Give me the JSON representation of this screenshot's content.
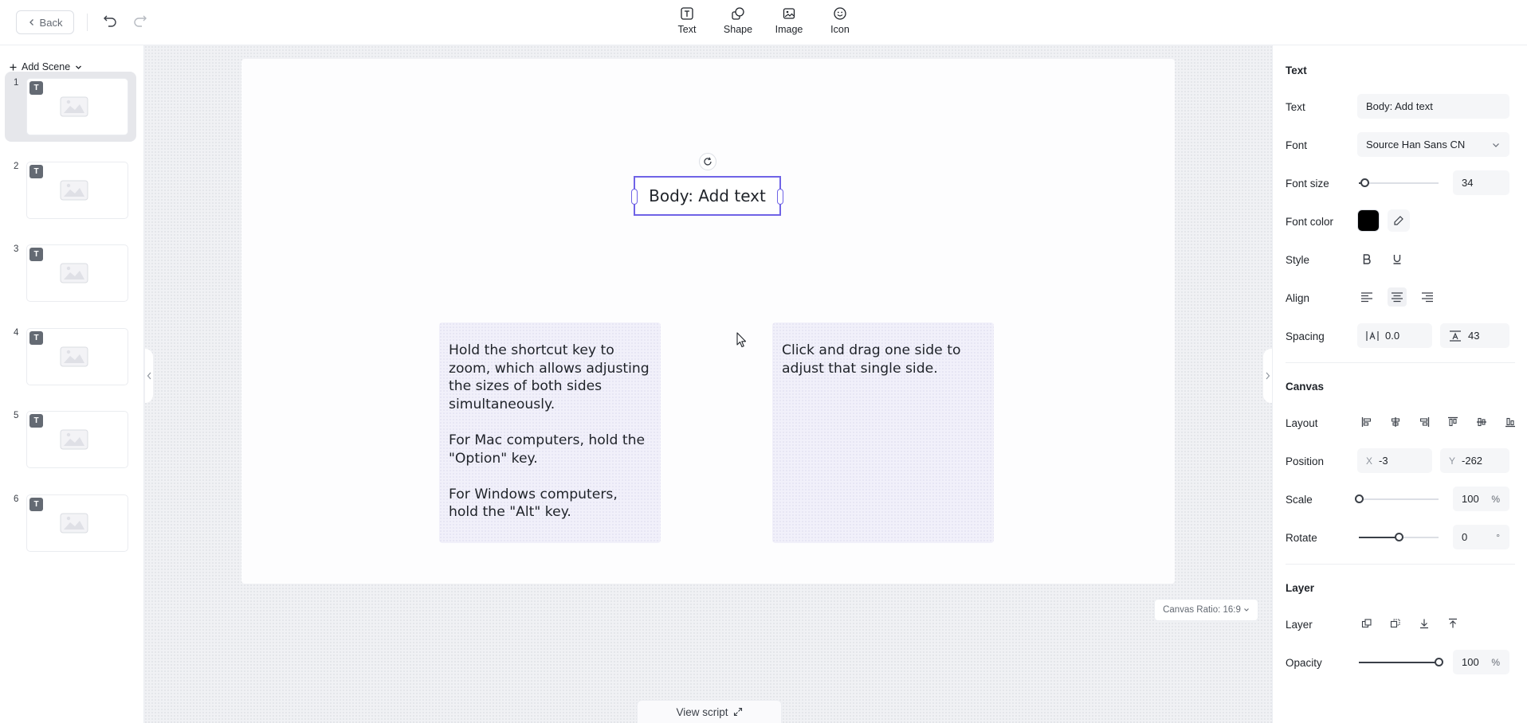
{
  "colors": {
    "accent": "#6f63e6",
    "font_color": "#000000",
    "card_bg": "#f1f0fa",
    "canvas_bg": "#f0f1f4"
  },
  "topbar": {
    "back_label": "Back",
    "tools": [
      {
        "label": "Text",
        "icon": "text-icon"
      },
      {
        "label": "Shape",
        "icon": "shape-icon"
      },
      {
        "label": "Image",
        "icon": "image-icon"
      },
      {
        "label": "Icon",
        "icon": "smiley-icon"
      }
    ]
  },
  "left_panel": {
    "add_scene_label": "Add Scene",
    "scenes": [
      {
        "number": "1",
        "badge": "T",
        "active": true
      },
      {
        "number": "2",
        "badge": "T",
        "active": false
      },
      {
        "number": "3",
        "badge": "T",
        "active": false
      },
      {
        "number": "4",
        "badge": "T",
        "active": false
      },
      {
        "number": "5",
        "badge": "T",
        "active": false
      },
      {
        "number": "6",
        "badge": "T",
        "active": false
      }
    ]
  },
  "canvas": {
    "selected_text": "Body: Add text",
    "card1": {
      "paragraphs": [
        "Hold the shortcut key to zoom, which allows adjusting the sizes of both sides simultaneously.",
        "For Mac computers, hold the \"Option\" key.",
        "For Windows computers, hold the \"Alt\" key."
      ]
    },
    "card2": {
      "paragraphs": [
        "Click and drag one side to adjust that single side."
      ]
    },
    "canvas_ratio_label": "Canvas Ratio: 16:9",
    "view_script_label": "View script"
  },
  "right_panel": {
    "text_section": {
      "title": "Text",
      "text_label": "Text",
      "text_value": "Body: Add text",
      "font_label": "Font",
      "font_value": "Source Han Sans CN",
      "font_size_label": "Font size",
      "font_size_value": "34",
      "font_size_level": 0.07,
      "font_color_label": "Font color",
      "style_label": "Style",
      "align_label": "Align",
      "spacing_label": "Spacing",
      "letter_spacing_value": "0.0",
      "line_spacing_value": "43"
    },
    "canvas_section": {
      "title": "Canvas",
      "layout_label": "Layout",
      "position_label": "Position",
      "x_label": "X",
      "x_value": "-3",
      "y_label": "Y",
      "y_value": "-262",
      "scale_label": "Scale",
      "scale_value": "100",
      "scale_level": 0.0,
      "percent_unit": "%",
      "rotate_label": "Rotate",
      "rotate_value": "0",
      "rotate_level": 0.5,
      "degree_unit": "°"
    },
    "layer_section": {
      "title": "Layer",
      "layer_label": "Layer",
      "opacity_label": "Opacity",
      "opacity_value": "100",
      "opacity_level": 1.0,
      "percent_unit": "%"
    }
  }
}
